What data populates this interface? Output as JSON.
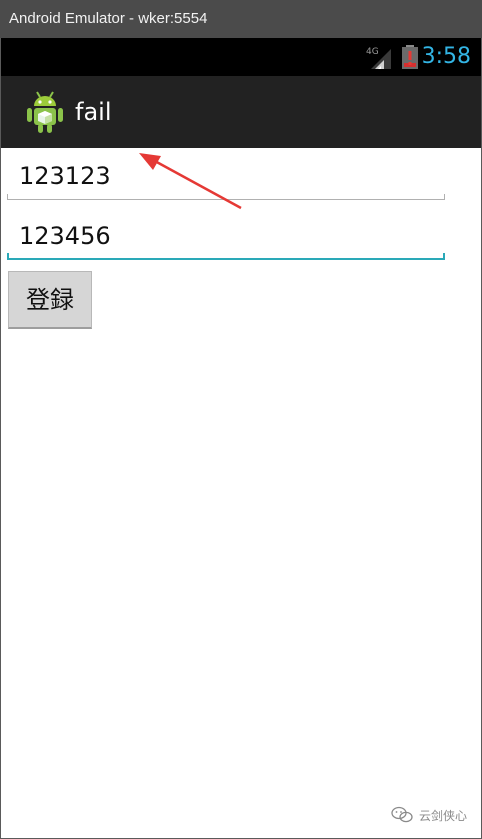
{
  "window": {
    "title": "Android Emulator - wker:5554"
  },
  "status_bar": {
    "network": "4G",
    "time": "3:58"
  },
  "action_bar": {
    "title": "fail",
    "icon": "android-robot-icon"
  },
  "form": {
    "username_value": "123123",
    "password_value": "123456",
    "login_label": "登録"
  },
  "watermark": {
    "text": "云剑侠心"
  },
  "colors": {
    "accent": "#33b5e5",
    "focus_underline": "#2aa9b8",
    "arrow": "#e53935",
    "actionbar": "#222222",
    "titlebar": "#4b4b4b"
  }
}
